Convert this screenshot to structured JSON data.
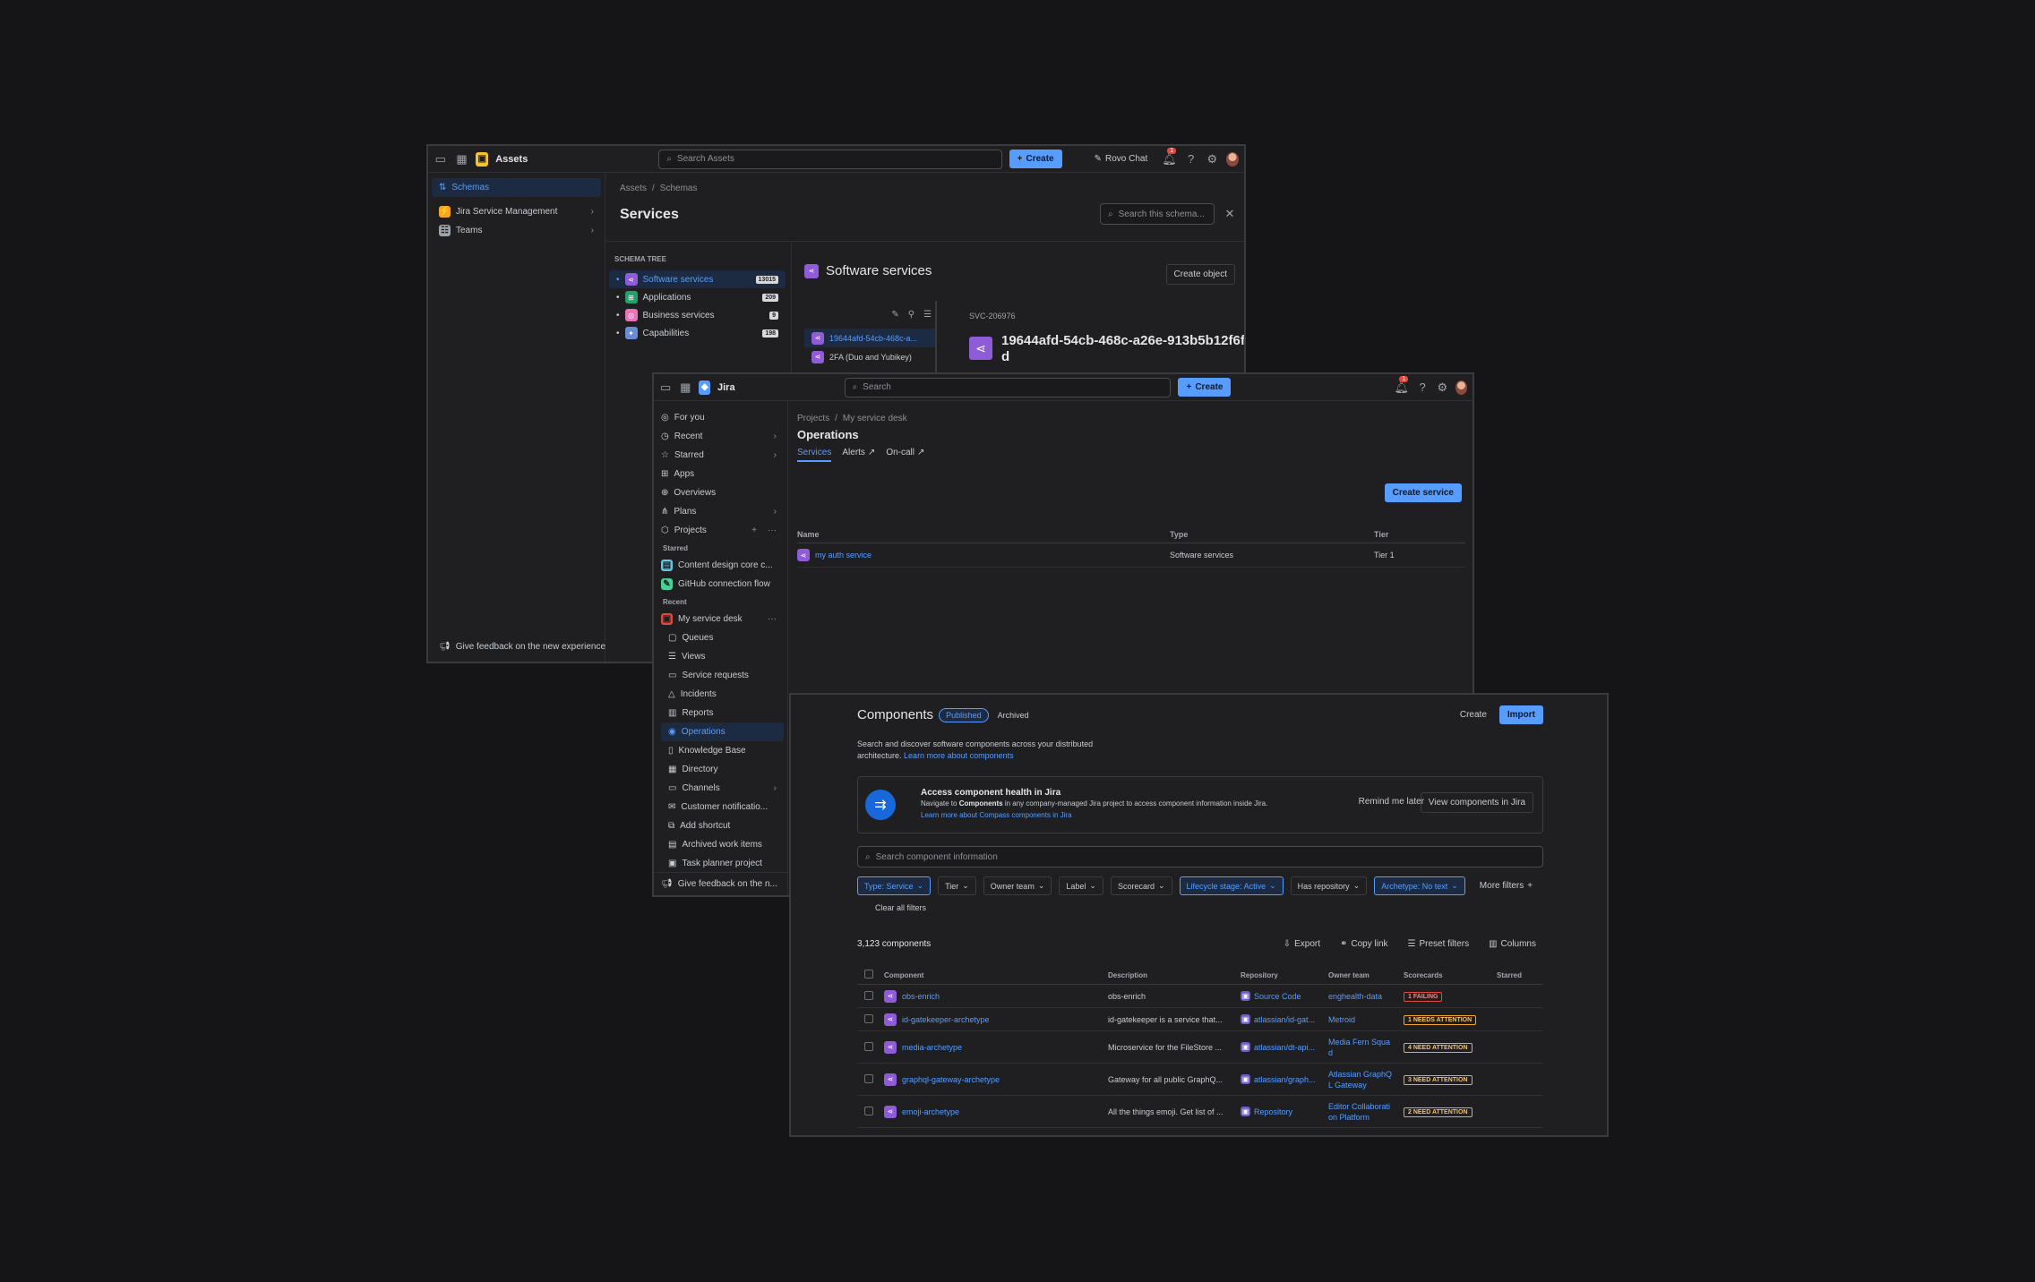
{
  "assets_window": {
    "app_title": "Assets",
    "search_placeholder": "Search Assets",
    "create_label": "Create",
    "rovo_label": "Rovo Chat",
    "notif_count": "1",
    "sidebar": {
      "items": [
        {
          "label": "Schemas"
        },
        {
          "label": "Jira Service Management"
        },
        {
          "label": "Teams"
        }
      ],
      "feedback": "Give feedback on the new experience"
    },
    "breadcrumb": [
      "Assets",
      "/",
      "Schemas"
    ],
    "page_title": "Services",
    "schema_search_placeholder": "Search this schema...",
    "schema_tree_label": "SCHEMA TREE",
    "schema_tree": [
      {
        "label": "Software services",
        "count": "13015",
        "color": "#8f5bd6"
      },
      {
        "label": "Applications",
        "count": "209",
        "color": "#22a06b"
      },
      {
        "label": "Business services",
        "count": "9",
        "color": "#e774bb"
      },
      {
        "label": "Capabilities",
        "count": "198",
        "color": "#6a8bd6"
      }
    ],
    "object_type_title": "Software services",
    "create_object_label": "Create object",
    "object_list": [
      {
        "label": "19644afd-54cb-468c-a..."
      },
      {
        "label": "2FA (Duo and Yubikey)"
      }
    ],
    "object_key": "SVC-206976",
    "object_title": "19644afd-54cb-468c-a26e-913b5b12f6fd"
  },
  "jira_window": {
    "app_title": "Jira",
    "search_placeholder": "Search",
    "create_label": "Create",
    "notif_count": "1",
    "nav": [
      {
        "label": "For you",
        "icon": "user-circle-icon"
      },
      {
        "label": "Recent",
        "icon": "clock-icon"
      },
      {
        "label": "Starred",
        "icon": "star-icon"
      },
      {
        "label": "Apps",
        "icon": "apps-icon"
      },
      {
        "label": "Overviews",
        "icon": "globe-icon"
      },
      {
        "label": "Plans",
        "icon": "plans-icon"
      },
      {
        "label": "Projects",
        "icon": "projects-icon"
      }
    ],
    "starred_label": "Starred",
    "starred": [
      {
        "label": "Content design core c..."
      },
      {
        "label": "GitHub connection flow"
      }
    ],
    "recent_label": "Recent",
    "project_name": "My service desk",
    "project_items": [
      {
        "label": "Queues"
      },
      {
        "label": "Views"
      },
      {
        "label": "Service requests"
      },
      {
        "label": "Incidents"
      },
      {
        "label": "Reports"
      },
      {
        "label": "Operations"
      },
      {
        "label": "Knowledge Base"
      },
      {
        "label": "Directory"
      },
      {
        "label": "Channels"
      },
      {
        "label": "Customer notificatio..."
      },
      {
        "label": "Add shortcut"
      },
      {
        "label": "Archived work items"
      },
      {
        "label": "Task planner project"
      }
    ],
    "feedback": "Give feedback on the n...",
    "breadcrumb": [
      "Projects",
      "/",
      "My service desk"
    ],
    "page_title": "Operations",
    "tabs": [
      {
        "label": "Services"
      },
      {
        "label": "Alerts"
      },
      {
        "label": "On-call"
      }
    ],
    "create_service_label": "Create service",
    "table": {
      "headers": [
        "Name",
        "Type",
        "Tier"
      ],
      "rows": [
        {
          "name": "my auth service",
          "type": "Software services",
          "tier": "Tier 1"
        }
      ]
    }
  },
  "compass_window": {
    "title": "Components",
    "status_published": "Published",
    "status_archived": "Archived",
    "create_label": "Create",
    "import_label": "Import",
    "intro_text": "Search and discover software components across your distributed architecture.",
    "intro_link": "Learn more about components",
    "banner": {
      "title": "Access component health in Jira",
      "text_pre": "Navigate to ",
      "text_bold": "Components",
      "text_post": " in any company-managed Jira project to access component information inside Jira.",
      "link": "Learn more about Compass components in Jira",
      "remind_label": "Remind me later",
      "view_label": "View components in Jira"
    },
    "search_placeholder": "Search component information",
    "filters": [
      {
        "label": "Type: Service",
        "on": true
      },
      {
        "label": "Tier",
        "on": false
      },
      {
        "label": "Owner team",
        "on": false
      },
      {
        "label": "Label",
        "on": false
      },
      {
        "label": "Scorecard",
        "on": false
      },
      {
        "label": "Lifecycle stage: Active",
        "on": true
      },
      {
        "label": "Has repository",
        "on": false
      },
      {
        "label": "Archetype: No text",
        "on": true
      }
    ],
    "more_filters_label": "More filters",
    "clear_filters_label": "Clear all filters",
    "count_label": "3,123 components",
    "actions": [
      {
        "label": "Export"
      },
      {
        "label": "Copy link"
      },
      {
        "label": "Preset filters"
      },
      {
        "label": "Columns"
      }
    ],
    "table": {
      "headers": [
        "Component",
        "Description",
        "Repository",
        "Owner team",
        "Scorecards",
        "Starred"
      ],
      "rows": [
        {
          "name": "obs-enrich",
          "desc": "obs-enrich",
          "repo": "Source Code",
          "owner": "enghealth-data",
          "score": "1 FAILING",
          "score_kind": "red"
        },
        {
          "name": "id-gatekeeper-archetype",
          "desc": "id-gatekeeper is a service that...",
          "repo": "atlassian/id-gat...",
          "owner": "Metroid",
          "score": "1 NEEDS ATTENTION",
          "score_kind": "orange"
        },
        {
          "name": "media-archetype",
          "desc": "Microservice for the FileStore ...",
          "repo": "atlassian/dt-api...",
          "owner": "Media Fern Squa d",
          "score": "4 NEED ATTENTION",
          "score_kind": "orange"
        },
        {
          "name": "graphql-gateway-archetype",
          "desc": "Gateway for all public GraphQ...",
          "repo": "atlassian/graph...",
          "owner": "Atlassian GraphQ L Gateway",
          "score": "3 NEED ATTENTION",
          "score_kind": "orange"
        },
        {
          "name": "emoji-archetype",
          "desc": "All the things emoji. Get list of ...",
          "repo": "Repository",
          "owner": "Editor Collaborati on Platform",
          "score": "2 NEED ATTENTION",
          "score_kind": "orange"
        }
      ]
    }
  }
}
